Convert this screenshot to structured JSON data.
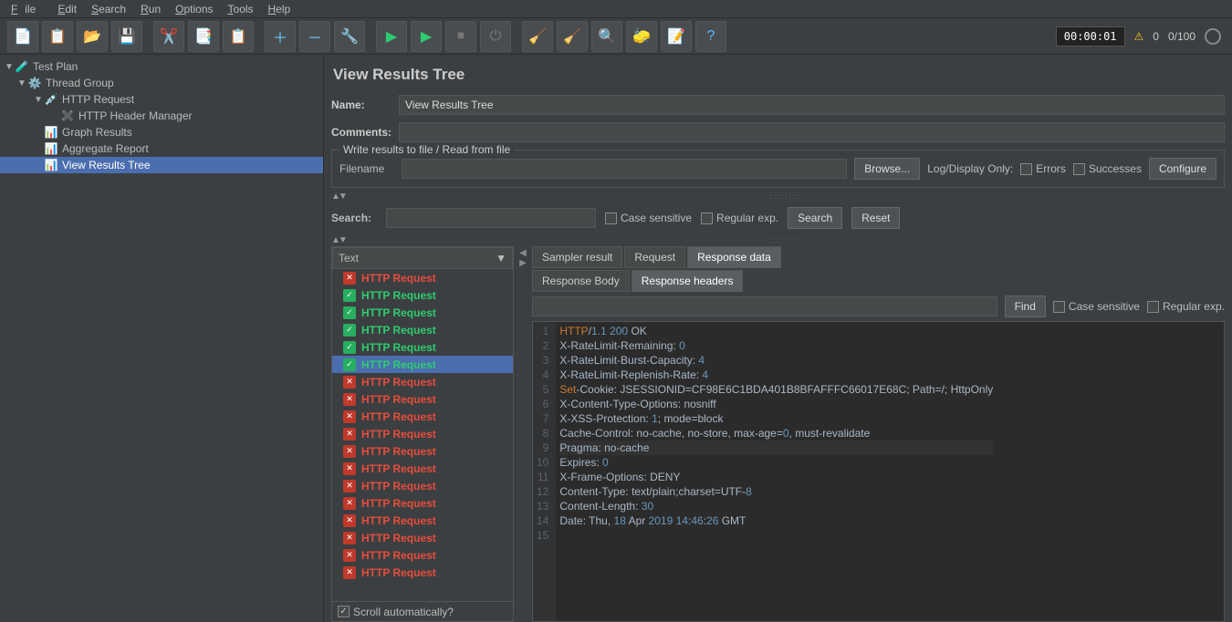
{
  "menu": {
    "file": "File",
    "edit": "Edit",
    "search": "Search",
    "run": "Run",
    "options": "Options",
    "tools": "Tools",
    "help": "Help"
  },
  "status": {
    "timer": "00:00:01",
    "warn_count": "0",
    "thread_count": "0/100"
  },
  "tree": {
    "test_plan": "Test Plan",
    "thread_group": "Thread Group",
    "http_request": "HTTP Request",
    "header_manager": "HTTP Header Manager",
    "graph_results": "Graph Results",
    "aggregate_report": "Aggregate Report",
    "view_results_tree": "View Results Tree"
  },
  "panel": {
    "title": "View Results Tree",
    "name_label": "Name:",
    "name_value": "View Results Tree",
    "comments_label": "Comments:",
    "file_legend": "Write results to file / Read from file",
    "filename_label": "Filename",
    "browse": "Browse...",
    "logdisplay": "Log/Display Only:",
    "errors": "Errors",
    "successes": "Successes",
    "configure": "Configure",
    "search_label": "Search:",
    "case_sensitive": "Case sensitive",
    "regex": "Regular exp.",
    "search_btn": "Search",
    "reset_btn": "Reset",
    "dropdown": "Text",
    "scroll_auto": "Scroll automatically?",
    "tabs": {
      "sampler": "Sampler result",
      "request": "Request",
      "response": "Response data"
    },
    "subtabs": {
      "body": "Response Body",
      "headers": "Response headers"
    },
    "find_btn": "Find",
    "find_case": "Case sensitive",
    "find_regex": "Regular exp."
  },
  "results": [
    {
      "label": "HTTP Request",
      "status": "fail"
    },
    {
      "label": "HTTP Request",
      "status": "pass"
    },
    {
      "label": "HTTP Request",
      "status": "pass"
    },
    {
      "label": "HTTP Request",
      "status": "pass"
    },
    {
      "label": "HTTP Request",
      "status": "pass"
    },
    {
      "label": "HTTP Request",
      "status": "pass",
      "selected": true
    },
    {
      "label": "HTTP Request",
      "status": "fail"
    },
    {
      "label": "HTTP Request",
      "status": "fail"
    },
    {
      "label": "HTTP Request",
      "status": "fail"
    },
    {
      "label": "HTTP Request",
      "status": "fail"
    },
    {
      "label": "HTTP Request",
      "status": "fail"
    },
    {
      "label": "HTTP Request",
      "status": "fail"
    },
    {
      "label": "HTTP Request",
      "status": "fail"
    },
    {
      "label": "HTTP Request",
      "status": "fail"
    },
    {
      "label": "HTTP Request",
      "status": "fail"
    },
    {
      "label": "HTTP Request",
      "status": "fail"
    },
    {
      "label": "HTTP Request",
      "status": "fail"
    },
    {
      "label": "HTTP Request",
      "status": "fail"
    }
  ],
  "response_lines": [
    {
      "n": 1,
      "segs": [
        {
          "t": "HTTP",
          "c": "kw"
        },
        {
          "t": "/",
          "c": "op"
        },
        {
          "t": "1.1",
          "c": "num"
        },
        {
          "t": " ",
          "c": "pl"
        },
        {
          "t": "200",
          "c": "num"
        },
        {
          "t": " OK",
          "c": "pl"
        }
      ]
    },
    {
      "n": 2,
      "segs": [
        {
          "t": "X-RateLimit-Remaining",
          "c": "pl"
        },
        {
          "t": ": ",
          "c": "op"
        },
        {
          "t": "0",
          "c": "num"
        }
      ]
    },
    {
      "n": 3,
      "segs": [
        {
          "t": "X-RateLimit-Burst-Capacity",
          "c": "pl"
        },
        {
          "t": ": ",
          "c": "op"
        },
        {
          "t": "4",
          "c": "num"
        }
      ]
    },
    {
      "n": 4,
      "segs": [
        {
          "t": "X-RateLimit-Replenish-Rate",
          "c": "pl"
        },
        {
          "t": ": ",
          "c": "op"
        },
        {
          "t": "4",
          "c": "num"
        }
      ]
    },
    {
      "n": 5,
      "segs": [
        {
          "t": "Set",
          "c": "kw"
        },
        {
          "t": "-Cookie",
          "c": "pl"
        },
        {
          "t": ": ",
          "c": "op"
        },
        {
          "t": "JSESSIONID=CF98E6C1BDA401B8BFAFFFC66017E68C",
          "c": "pl"
        },
        {
          "t": "; ",
          "c": "op"
        },
        {
          "t": "Path=/",
          "c": "pl"
        },
        {
          "t": "; ",
          "c": "op"
        },
        {
          "t": "HttpOnly",
          "c": "pl"
        }
      ]
    },
    {
      "n": 6,
      "segs": [
        {
          "t": "X-Content-Type-Options",
          "c": "pl"
        },
        {
          "t": ": ",
          "c": "op"
        },
        {
          "t": "nosniff",
          "c": "pl"
        }
      ]
    },
    {
      "n": 7,
      "segs": [
        {
          "t": "X-XSS-Protection",
          "c": "pl"
        },
        {
          "t": ": ",
          "c": "op"
        },
        {
          "t": "1",
          "c": "num"
        },
        {
          "t": "; ",
          "c": "op"
        },
        {
          "t": "mode=block",
          "c": "pl"
        }
      ]
    },
    {
      "n": 8,
      "segs": [
        {
          "t": "Cache-Control",
          "c": "pl"
        },
        {
          "t": ": ",
          "c": "op"
        },
        {
          "t": "no-cache",
          "c": "pl"
        },
        {
          "t": ", ",
          "c": "op"
        },
        {
          "t": "no-store",
          "c": "pl"
        },
        {
          "t": ", ",
          "c": "op"
        },
        {
          "t": "max-age=",
          "c": "pl"
        },
        {
          "t": "0",
          "c": "num"
        },
        {
          "t": ", ",
          "c": "op"
        },
        {
          "t": "must-revalidate",
          "c": "pl"
        }
      ]
    },
    {
      "n": 9,
      "hl": true,
      "segs": [
        {
          "t": "Pragma",
          "c": "pl"
        },
        {
          "t": ": ",
          "c": "op"
        },
        {
          "t": "no-cache",
          "c": "pl"
        }
      ]
    },
    {
      "n": 10,
      "segs": [
        {
          "t": "Expires",
          "c": "pl"
        },
        {
          "t": ": ",
          "c": "op"
        },
        {
          "t": "0",
          "c": "num"
        }
      ]
    },
    {
      "n": 11,
      "segs": [
        {
          "t": "X-Frame-Options",
          "c": "pl"
        },
        {
          "t": ": ",
          "c": "op"
        },
        {
          "t": "DENY",
          "c": "pl"
        }
      ]
    },
    {
      "n": 12,
      "segs": [
        {
          "t": "Content-Type",
          "c": "pl"
        },
        {
          "t": ": ",
          "c": "op"
        },
        {
          "t": "text/plain",
          "c": "pl"
        },
        {
          "t": ";",
          "c": "op"
        },
        {
          "t": "charset=UTF-",
          "c": "pl"
        },
        {
          "t": "8",
          "c": "num"
        }
      ]
    },
    {
      "n": 13,
      "segs": [
        {
          "t": "Content-Length",
          "c": "pl"
        },
        {
          "t": ": ",
          "c": "op"
        },
        {
          "t": "30",
          "c": "num"
        }
      ]
    },
    {
      "n": 14,
      "segs": [
        {
          "t": "Date",
          "c": "pl"
        },
        {
          "t": ": ",
          "c": "op"
        },
        {
          "t": "Thu",
          "c": "pl"
        },
        {
          "t": ", ",
          "c": "op"
        },
        {
          "t": "18",
          "c": "num"
        },
        {
          "t": " Apr ",
          "c": "pl"
        },
        {
          "t": "2019",
          "c": "num"
        },
        {
          "t": " ",
          "c": "pl"
        },
        {
          "t": "14",
          "c": "num"
        },
        {
          "t": ":",
          "c": "op"
        },
        {
          "t": "46",
          "c": "num"
        },
        {
          "t": ":",
          "c": "op"
        },
        {
          "t": "26",
          "c": "num"
        },
        {
          "t": " GMT",
          "c": "pl"
        }
      ]
    },
    {
      "n": 15,
      "segs": []
    }
  ]
}
